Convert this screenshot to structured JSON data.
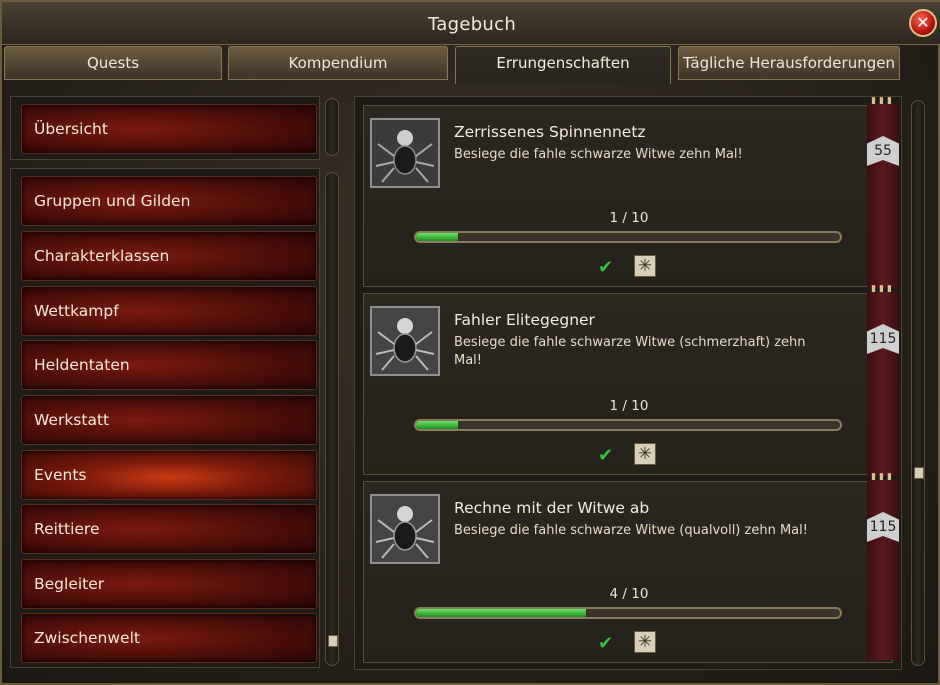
{
  "window": {
    "title": "Tagebuch"
  },
  "tabs": [
    {
      "label": "Quests"
    },
    {
      "label": "Kompendium"
    },
    {
      "label": "Errungenschaften"
    },
    {
      "label": "Tägliche Herausforderungen"
    }
  ],
  "active_tab": 2,
  "sidebar": {
    "top_item": {
      "label": "Übersicht"
    },
    "items": [
      {
        "label": "Gruppen und Gilden"
      },
      {
        "label": "Charakterklassen"
      },
      {
        "label": "Wettkampf"
      },
      {
        "label": "Heldentaten"
      },
      {
        "label": "Werkstatt"
      },
      {
        "label": "Events"
      },
      {
        "label": "Reittiere"
      },
      {
        "label": "Begleiter"
      },
      {
        "label": "Zwischenwelt"
      }
    ],
    "active_index": 5
  },
  "achievements": [
    {
      "title": "Zerrissenes Spinnennetz",
      "description": "Besiege die fahle schwarze Witwe zehn Mal!",
      "progress_text": "1 / 10",
      "progress_fraction": 0.1,
      "points": "55",
      "icon": "spider-widow-icon"
    },
    {
      "title": "Fahler Elitegegner",
      "description": "Besiege die fahle schwarze Witwe (schmerzhaft) zehn Mal!",
      "progress_text": "1 / 10",
      "progress_fraction": 0.1,
      "points": "115",
      "icon": "spider-widow-icon"
    },
    {
      "title": "Rechne mit der Witwe ab",
      "description": "Besiege die fahle schwarze Witwe (qualvoll) zehn Mal!",
      "progress_text": "4 / 10",
      "progress_fraction": 0.4,
      "points": "115",
      "icon": "spider-widow-icon"
    }
  ],
  "colors": {
    "progress_fill": "#2fae2c",
    "nav_active": "#c83a12",
    "close_button": "#c81e12"
  }
}
